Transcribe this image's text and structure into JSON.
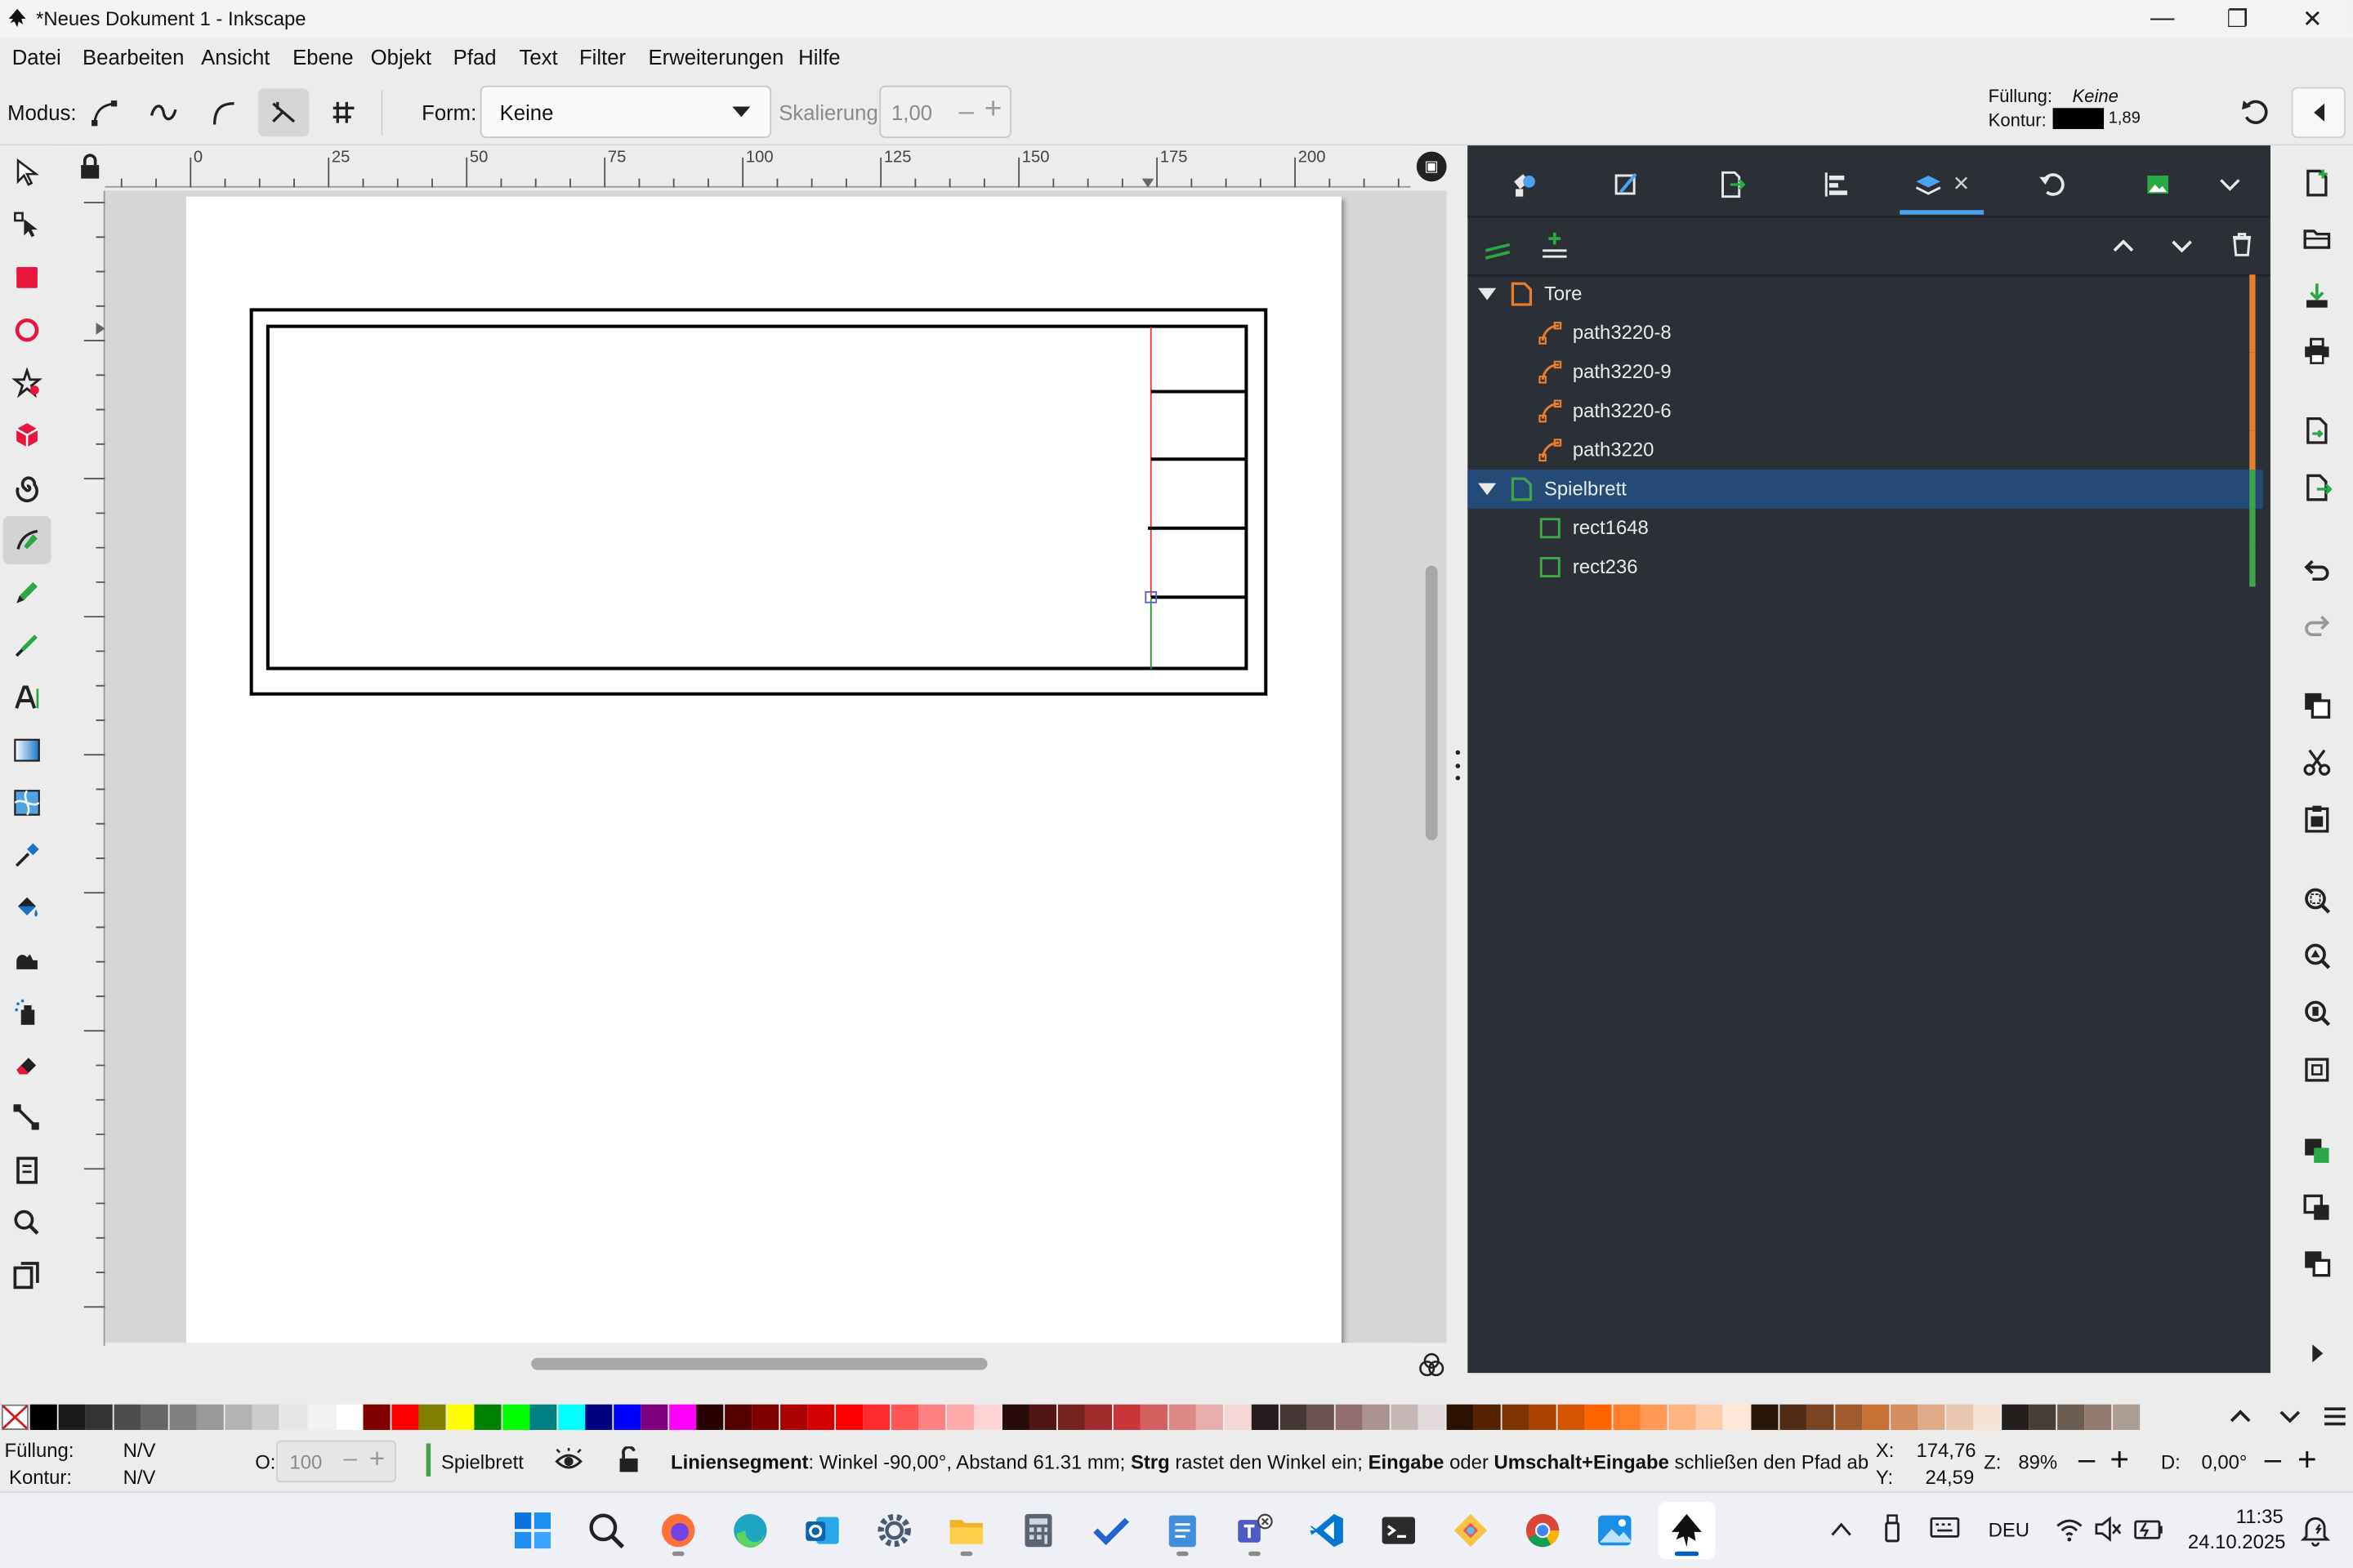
{
  "window": {
    "title": "*Neues Dokument 1 - Inkscape"
  },
  "menu": [
    "Datei",
    "Bearbeiten",
    "Ansicht",
    "Ebene",
    "Objekt",
    "Pfad",
    "Text",
    "Filter",
    "Erweiterungen",
    "Hilfe"
  ],
  "toolcontrols": {
    "mode_label": "Modus:",
    "shape_label": "Form:",
    "shape_value": "Keine",
    "scale_label": "Skalierung:",
    "scale_value": "1,00"
  },
  "style_indicator": {
    "fill_label": "Füllung:",
    "fill_value": "Keine",
    "stroke_label": "Kontur:",
    "stroke_width": "1,89"
  },
  "ruler": {
    "h_ticks": [
      "0",
      "25",
      "50",
      "75",
      "100",
      "125",
      "150",
      "175",
      "200"
    ]
  },
  "layers": {
    "items": [
      {
        "name": "Tore",
        "type": "layer",
        "level": 0,
        "color": "#e87d2c",
        "expanded": true,
        "selected": false
      },
      {
        "name": "path3220-8",
        "type": "path",
        "level": 1,
        "color": "#e87d2c"
      },
      {
        "name": "path3220-9",
        "type": "path",
        "level": 1,
        "color": "#e87d2c"
      },
      {
        "name": "path3220-6",
        "type": "path",
        "level": 1,
        "color": "#e87d2c"
      },
      {
        "name": "path3220",
        "type": "path",
        "level": 1,
        "color": "#e87d2c"
      },
      {
        "name": "Spielbrett",
        "type": "layer",
        "level": 0,
        "color": "#3fa34d",
        "expanded": true,
        "selected": true
      },
      {
        "name": "rect1648",
        "type": "rect",
        "level": 1,
        "color": "#3fa34d"
      },
      {
        "name": "rect236",
        "type": "rect",
        "level": 1,
        "color": "#3fa34d"
      }
    ]
  },
  "palette": [
    "#000000",
    "#1a1a1a",
    "#333333",
    "#4d4d4d",
    "#666666",
    "#808080",
    "#999999",
    "#b3b3b3",
    "#cccccc",
    "#e6e6e6",
    "#f2f2f2",
    "#ffffff",
    "#800000",
    "#ff0000",
    "#808000",
    "#ffff00",
    "#008000",
    "#00ff00",
    "#008080",
    "#00ffff",
    "#000080",
    "#0000ff",
    "#800080",
    "#ff00ff",
    "#2b0000",
    "#550000",
    "#800000",
    "#aa0000",
    "#d40000",
    "#ff0000",
    "#ff2a2a",
    "#ff5555",
    "#ff8080",
    "#ffaaaa",
    "#ffd5d5",
    "#280b0b",
    "#501616",
    "#782121",
    "#a02c2c",
    "#c83737",
    "#d35f5f",
    "#de8787",
    "#e9afaf",
    "#f4d7d7",
    "#241c1c",
    "#483737",
    "#6c5353",
    "#916f6f",
    "#ac9393",
    "#c8b7b7",
    "#e3dbdb",
    "#2b1100",
    "#552200",
    "#803300",
    "#aa4400",
    "#d45500",
    "#ff6600",
    "#ff7f2a",
    "#ff9955",
    "#ffb380",
    "#ffccaa",
    "#ffe6d5",
    "#28170b",
    "#502d16",
    "#784421",
    "#a05a2c",
    "#c87137",
    "#d38d5f",
    "#deaa87",
    "#e9c6af",
    "#f4e3d7",
    "#241f1c",
    "#483e37",
    "#6c5d53",
    "#917c6f",
    "#ac9d93"
  ],
  "statusbar": {
    "fill_label": "Füllung:",
    "fill_value": "N/V",
    "stroke_label": "Kontur:",
    "stroke_value": "N/V",
    "opacity_label": "O:",
    "opacity_value": "100",
    "layer": "Spielbrett",
    "message_bold1": "Liniensegment",
    "message_text1": ": Winkel -90,00°, Abstand 61.31 mm; ",
    "message_bold2": "Strg",
    "message_text2": " rastet den Winkel ein; ",
    "message_bold3": "Eingabe",
    "message_text3": " oder ",
    "message_bold4": "Umschalt+Eingabe",
    "message_text4": " schließen den Pfad ab",
    "x_label": "X:",
    "x_value": "174,76",
    "y_label": "Y:",
    "y_value": "24,59",
    "zoom_label": "Z:",
    "zoom_value": "89%",
    "rotation_label": "D:",
    "rotation_value": "0,00°"
  },
  "taskbar": {
    "apps": [
      "start-icon",
      "search-icon",
      "firefox-icon",
      "edge-icon",
      "outlook-icon",
      "settings-icon",
      "explorer-icon",
      "calculator-icon",
      "todo-icon",
      "notepad-icon",
      "teams-icon",
      "vscode-icon",
      "terminal-icon",
      "git-icon",
      "chrome-icon",
      "photos-icon",
      "inkscape-icon"
    ],
    "language": "DEU",
    "time": "11:35",
    "date": "24.10.2025"
  }
}
